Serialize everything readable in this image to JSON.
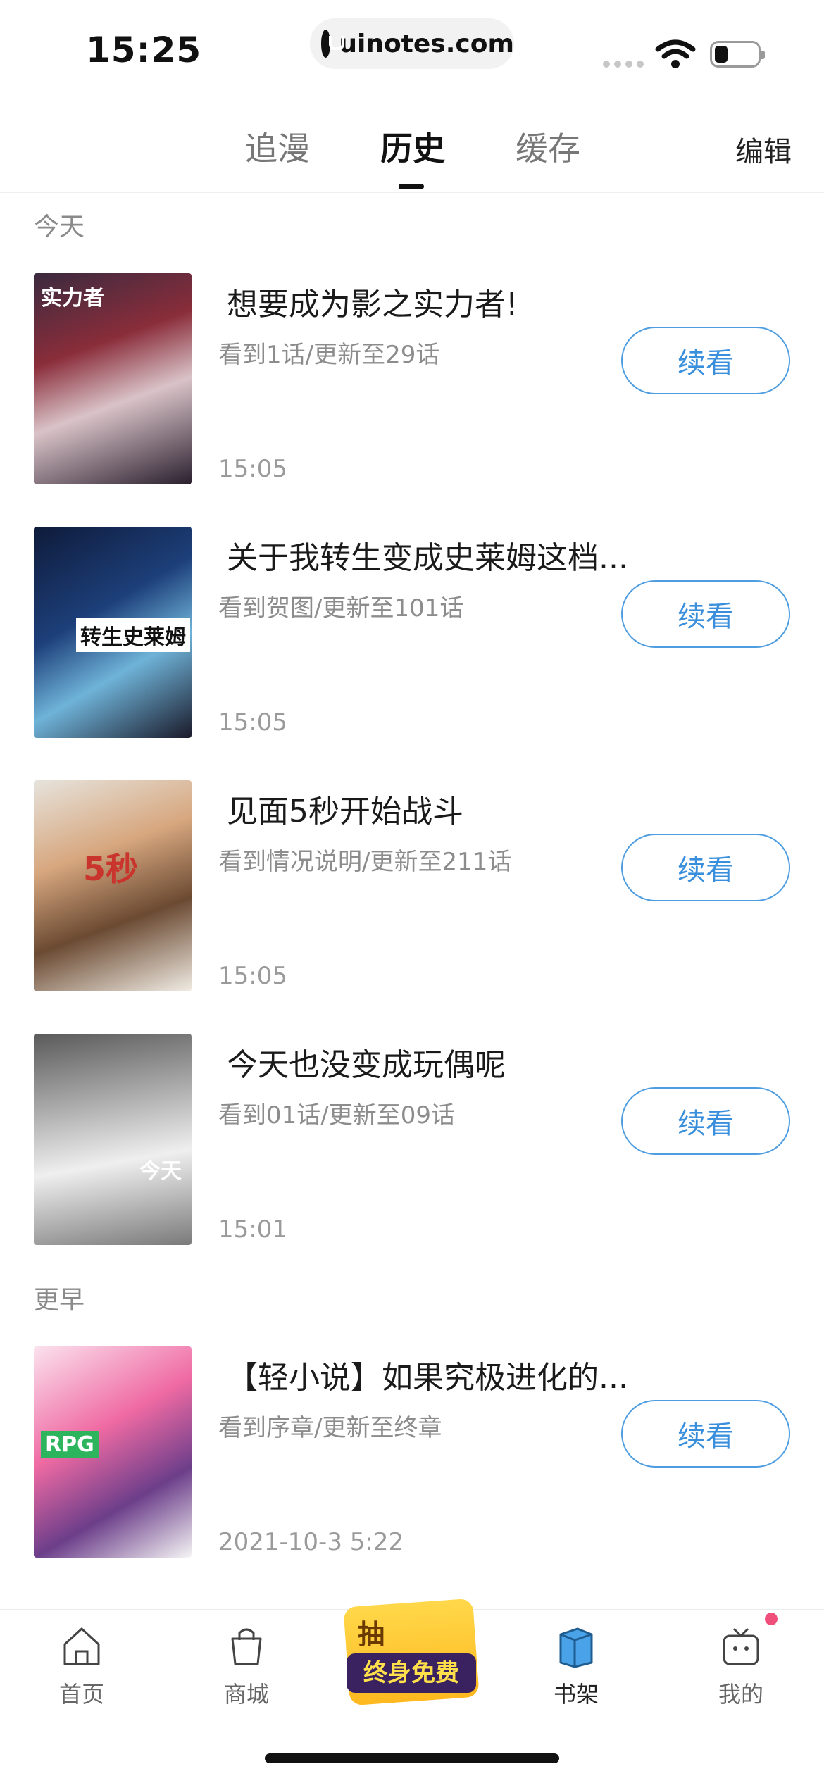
{
  "status_bar": {
    "time": "15:25",
    "url": "uinotes.com"
  },
  "tabs": {
    "items": [
      "追漫",
      "历史",
      "缓存"
    ],
    "active": "历史",
    "edit_label": "编辑"
  },
  "sections": {
    "today": "今天",
    "earlier": "更早"
  },
  "items": [
    {
      "title": "想要成为影之实力者!",
      "progress": "看到1话/更新至29话",
      "time": "15:05",
      "button": "续看",
      "cover_text": "实力者"
    },
    {
      "title": "关于我转生变成史莱姆这档...",
      "progress": "看到贺图/更新至101话",
      "time": "15:05",
      "button": "续看",
      "cover_text": "转生史莱姆"
    },
    {
      "title": "见面5秒开始战斗",
      "progress": "看到情况说明/更新至211话",
      "time": "15:05",
      "button": "续看",
      "cover_text": "5秒"
    },
    {
      "title": "今天也没变成玩偶呢",
      "progress": "看到01话/更新至09话",
      "time": "15:01",
      "button": "续看",
      "cover_text": "今天"
    },
    {
      "title": "【轻小说】如果究极进化的...",
      "progress": "看到序章/更新至终章",
      "time": "2021-10-3 5:22",
      "button": "续看",
      "cover_text": "RPG"
    }
  ],
  "bottom_nav": {
    "home": "首页",
    "store": "商城",
    "promo_top": "抽",
    "promo": "终身免费",
    "shelf": "书架",
    "me": "我的"
  },
  "colors": {
    "accent": "#3a8fdc",
    "badge": "#ef4f7a"
  }
}
